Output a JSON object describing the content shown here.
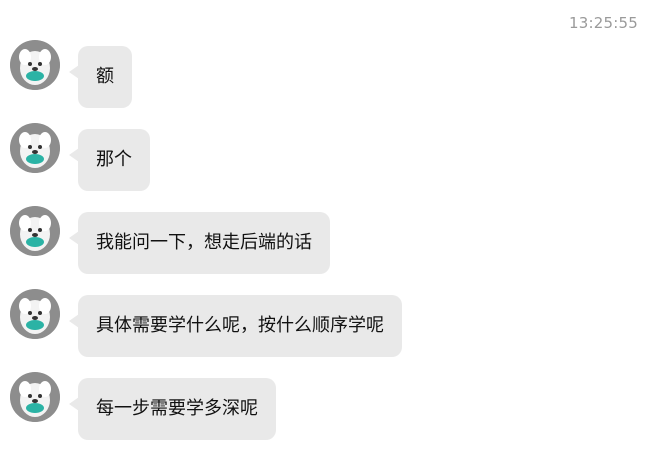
{
  "header": {
    "timestamp": "13:25:55"
  },
  "messages": [
    {
      "text": "额"
    },
    {
      "text": "那个"
    },
    {
      "text": "我能问一下，想走后端的话"
    },
    {
      "text": "具体需要学什么呢，按什么顺序学呢"
    },
    {
      "text": "每一步需要学多深呢"
    }
  ],
  "colors": {
    "bubble_bg": "#e9e9e9",
    "timestamp_text": "#9a9a9a",
    "message_text": "#111111",
    "avatar_accent": "#2bb3a5"
  },
  "icons": {
    "avatar": "samoyed-dog-avatar-icon"
  }
}
